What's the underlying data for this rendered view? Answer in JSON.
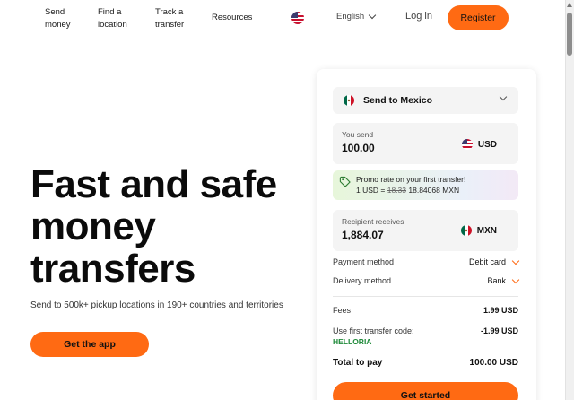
{
  "nav": {
    "send_money": "Send money",
    "find_location": "Find a location",
    "track_transfer": "Track a transfer",
    "resources": "Resources",
    "language": "English",
    "login": "Log in",
    "register": "Register"
  },
  "hero": {
    "title": "Fast and safe money transfers",
    "subtitle": "Send to 500k+ pickup locations in 190+ countries and territories",
    "cta": "Get the app"
  },
  "calculator": {
    "destination": "Send to Mexico",
    "you_send_label": "You send",
    "you_send_value": "100.00",
    "send_currency": "USD",
    "promo_line1": "Promo rate on your first transfer!",
    "promo_rate_prefix": "1 USD = ",
    "promo_old_rate": "18.33",
    "promo_new_rate": "18.84068 MXN",
    "recipient_label": "Recipient receives",
    "recipient_value": "1,884.07",
    "recipient_currency": "MXN",
    "payment_method_label": "Payment method",
    "payment_method_value": "Debit card",
    "delivery_method_label": "Delivery method",
    "delivery_method_value": "Bank",
    "fees_label": "Fees",
    "fees_value": "1.99 USD",
    "first_code_label": "Use first transfer code:",
    "first_code": "HELLORIA",
    "first_code_discount": "-1.99 USD",
    "total_label": "Total to pay",
    "total_value": "100.00 USD",
    "start_button": "Get started"
  },
  "colors": {
    "accent": "#ff6a13",
    "discount_green": "#1f8a3a",
    "text": "#111111"
  },
  "icons": [
    "us-flag-icon",
    "mexico-flag-icon",
    "chevron-down-icon",
    "tag-icon"
  ]
}
